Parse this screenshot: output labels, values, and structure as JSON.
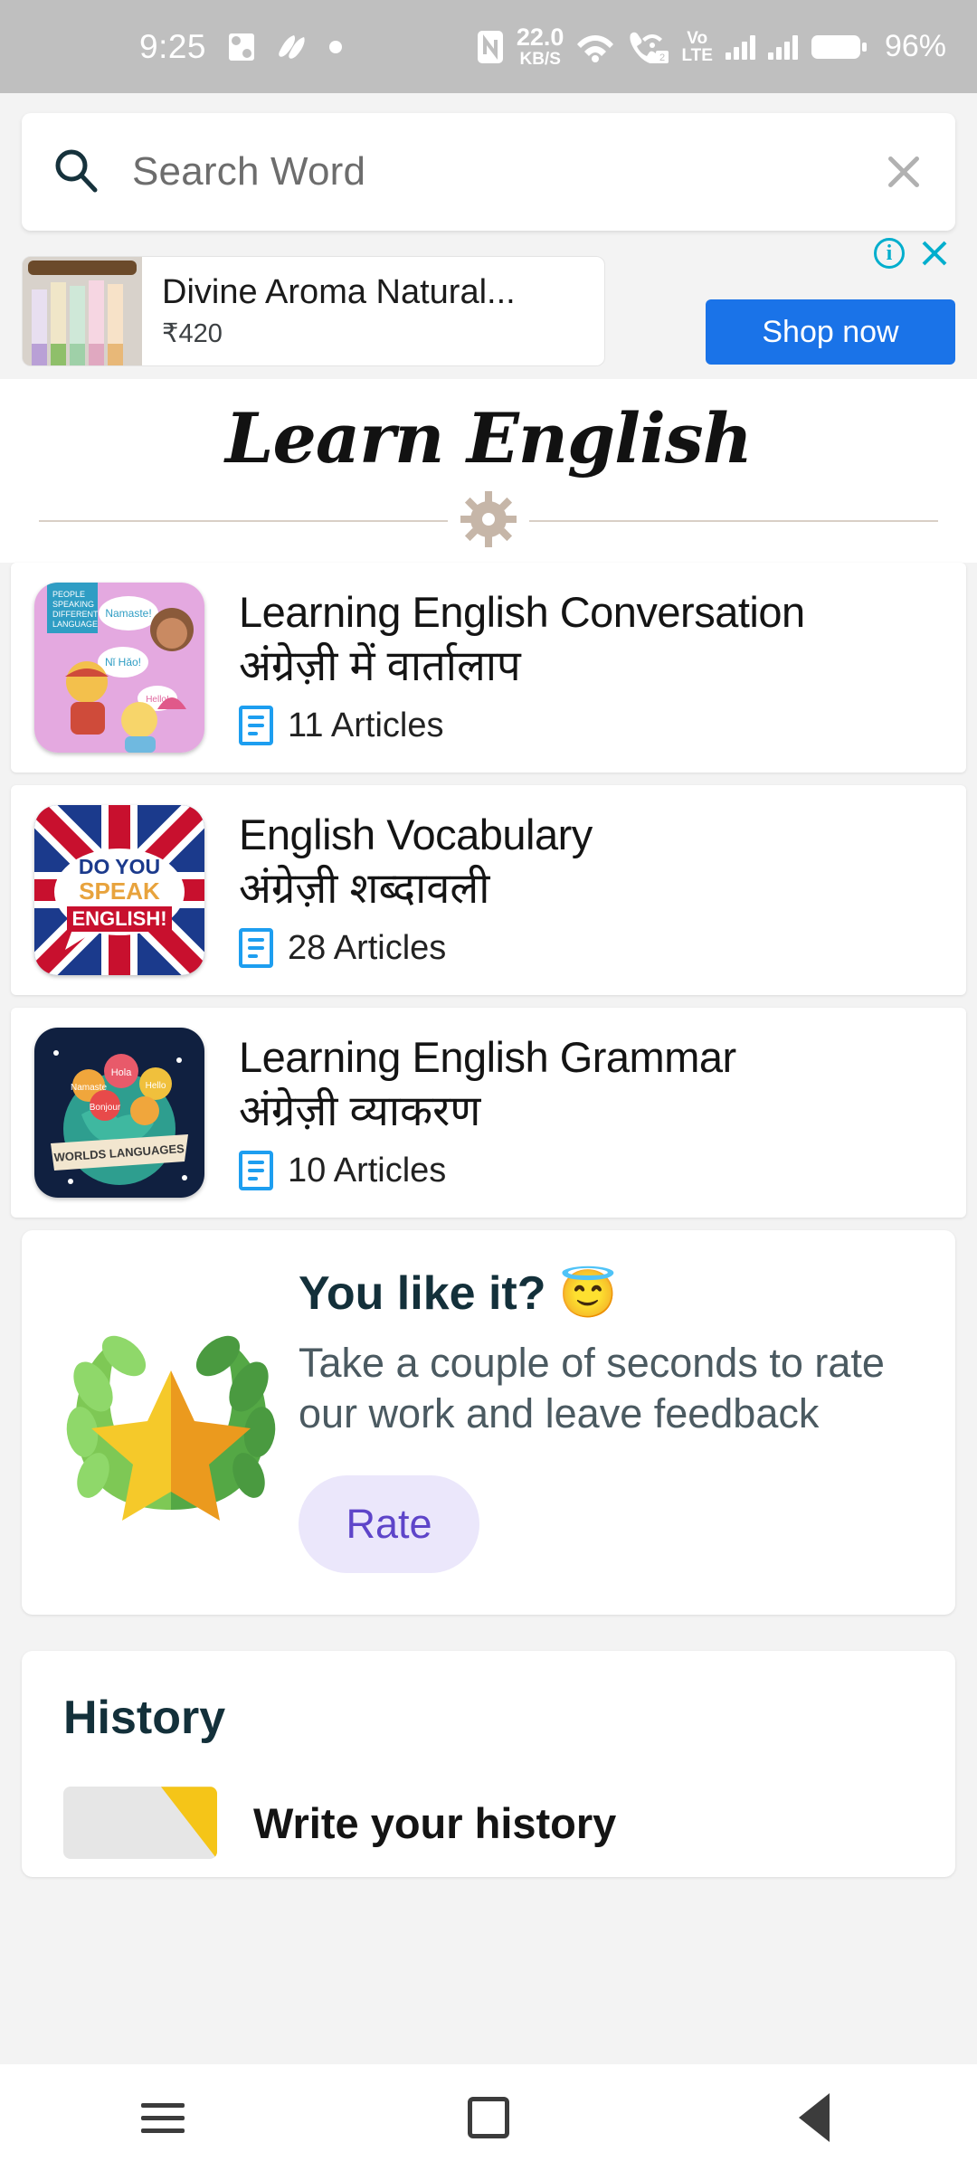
{
  "status_bar": {
    "time": "9:25",
    "icons_left": [
      "health-icon",
      "app-icon",
      "dot-icon"
    ],
    "nfc": "nfc-icon",
    "network_speed_value": "22.0",
    "network_speed_unit": "KB/S",
    "wifi": "wifi-icon",
    "call": "call-wifi-icon",
    "sim_badge": "2",
    "volte_line1": "Vo",
    "volte_line2": "LTE",
    "battery_percent": "96%"
  },
  "search": {
    "placeholder": "Search Word",
    "value": "",
    "clear_label": "×"
  },
  "ad": {
    "title": "Divine Aroma Natural...",
    "price": "₹420",
    "cta": "Shop now",
    "info_badge": "i",
    "close_badge": "×"
  },
  "brand": {
    "title": "Learn English"
  },
  "categories": [
    {
      "title_en": "Learning English Conversation",
      "title_hi": "अंग्रेज़ी में वार्तालाप",
      "articles": "11 Articles"
    },
    {
      "title_en": "English Vocabulary",
      "title_hi": "अंग्रेज़ी शब्दावली",
      "articles": "28 Articles"
    },
    {
      "title_en": "Learning English Grammar",
      "title_hi": "अंग्रेज़ी व्याकरण",
      "articles": "10 Articles"
    }
  ],
  "rate_card": {
    "heading": "You like it?",
    "emoji": "😇",
    "body": "Take a couple of seconds to rate our work and leave feedback",
    "button": "Rate"
  },
  "history": {
    "heading": "History",
    "first_item": "Write your history"
  },
  "navbar": {
    "recents": "recents-icon",
    "home": "home-icon",
    "back": "back-icon"
  },
  "colors": {
    "accent_blue": "#1a73e8",
    "ad_badge": "#00aecd",
    "article_blue": "#1d9ef0",
    "rate_button_bg": "#ebe7fb",
    "rate_button_fg": "#5e45c9",
    "status_bar_bg": "#bfbfbf"
  }
}
